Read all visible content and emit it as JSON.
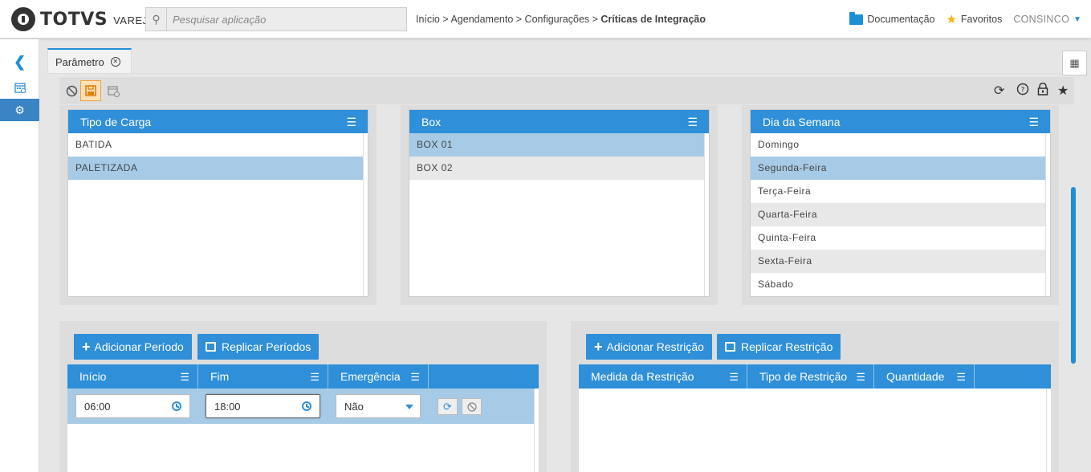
{
  "header": {
    "logo_text": "TOTVS",
    "logo_sub": "VAREJO",
    "search_placeholder": "Pesquisar aplicação",
    "breadcrumb": [
      "Início",
      "Agendamento",
      "Configurações"
    ],
    "breadcrumb_current": "Críticas de Integração",
    "docs_label": "Documentação",
    "favorites_label": "Favoritos",
    "user_label": "CONSINCO"
  },
  "tab": {
    "label": "Parâmetro"
  },
  "panels": {
    "tipo_carga": {
      "title": "Tipo de Carga",
      "rows": [
        {
          "label": "BATIDA",
          "selected": false
        },
        {
          "label": "PALETIZADA",
          "selected": true
        }
      ]
    },
    "box": {
      "title": "Box",
      "rows": [
        {
          "label": "BOX 01",
          "selected": true
        },
        {
          "label": "BOX 02",
          "selected": false
        }
      ]
    },
    "dia_semana": {
      "title": "Dia da Semana",
      "rows": [
        {
          "label": "Domingo",
          "selected": false
        },
        {
          "label": "Segunda-Feira",
          "selected": true
        },
        {
          "label": "Terça-Feira",
          "selected": false
        },
        {
          "label": "Quarta-Feira",
          "selected": false
        },
        {
          "label": "Quinta-Feira",
          "selected": false
        },
        {
          "label": "Sexta-Feira",
          "selected": false
        },
        {
          "label": "Sábado",
          "selected": false
        }
      ]
    }
  },
  "periodos": {
    "add_label": "Adicionar Período",
    "replicate_label": "Replicar Períodos",
    "columns": [
      "Início",
      "Fim",
      "Emergência"
    ],
    "row": {
      "inicio": "06:00",
      "fim": "18:00",
      "emergencia": "Não"
    }
  },
  "restricoes": {
    "add_label": "Adicionar Restrição",
    "replicate_label": "Replicar Restrição",
    "columns": [
      "Medida da Restrição",
      "Tipo de Restrição",
      "Quantidade"
    ]
  },
  "colors": {
    "primary": "#2f8fd8",
    "selected_row": "#a7cbe6"
  }
}
